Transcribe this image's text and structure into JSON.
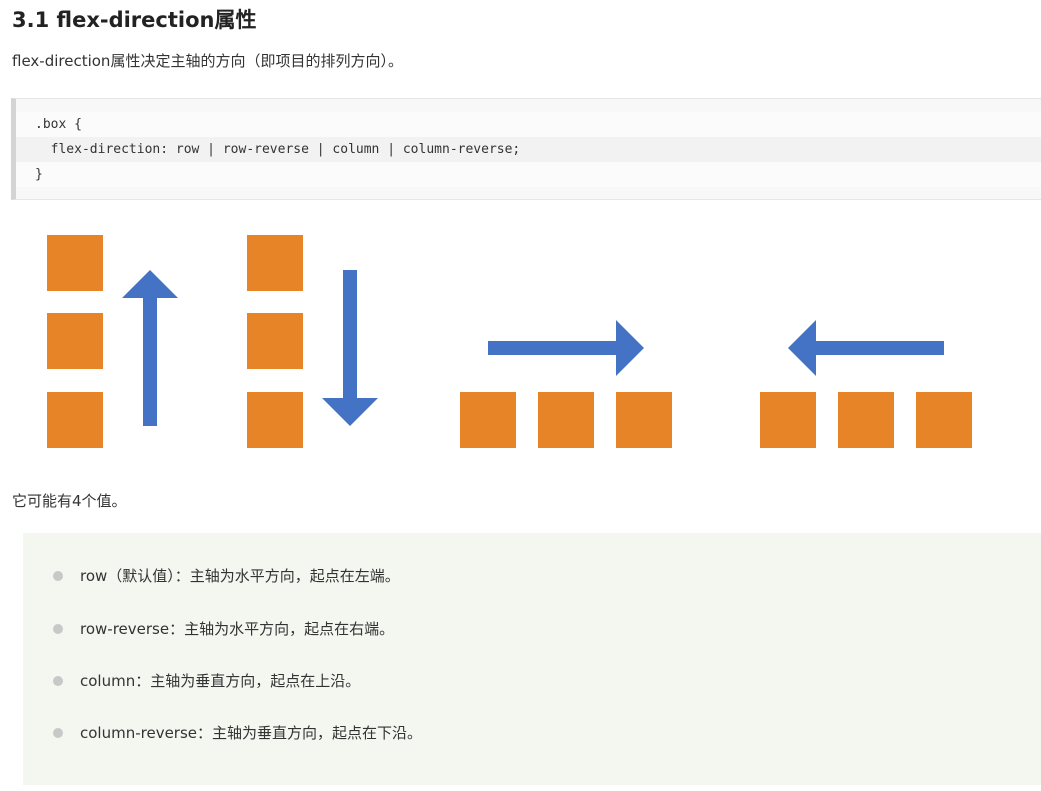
{
  "heading": "3.1 flex-direction属性",
  "intro": "flex-direction属性决定主轴的方向（即项目的排列方向）。",
  "code": {
    "line1": ".box {",
    "line2": "  flex-direction: row | row-reverse | column | column-reverse;",
    "line3": "}"
  },
  "colors": {
    "box_fill": "#e88428",
    "arrow_fill": "#4472c4",
    "code_background": "#f8f8f8",
    "list_background": "#f4f6f0"
  },
  "diagram": {
    "panels": [
      {
        "direction": "up",
        "item_count": 3
      },
      {
        "direction": "down",
        "item_count": 3
      },
      {
        "direction": "right",
        "item_count": 3
      },
      {
        "direction": "left",
        "item_count": 3
      }
    ]
  },
  "values_intro": "它可能有4个值。",
  "values": [
    "row（默认值）：主轴为水平方向，起点在左端。",
    "row-reverse：主轴为水平方向，起点在右端。",
    "column：主轴为垂直方向，起点在上沿。",
    "column-reverse：主轴为垂直方向，起点在下沿。"
  ]
}
